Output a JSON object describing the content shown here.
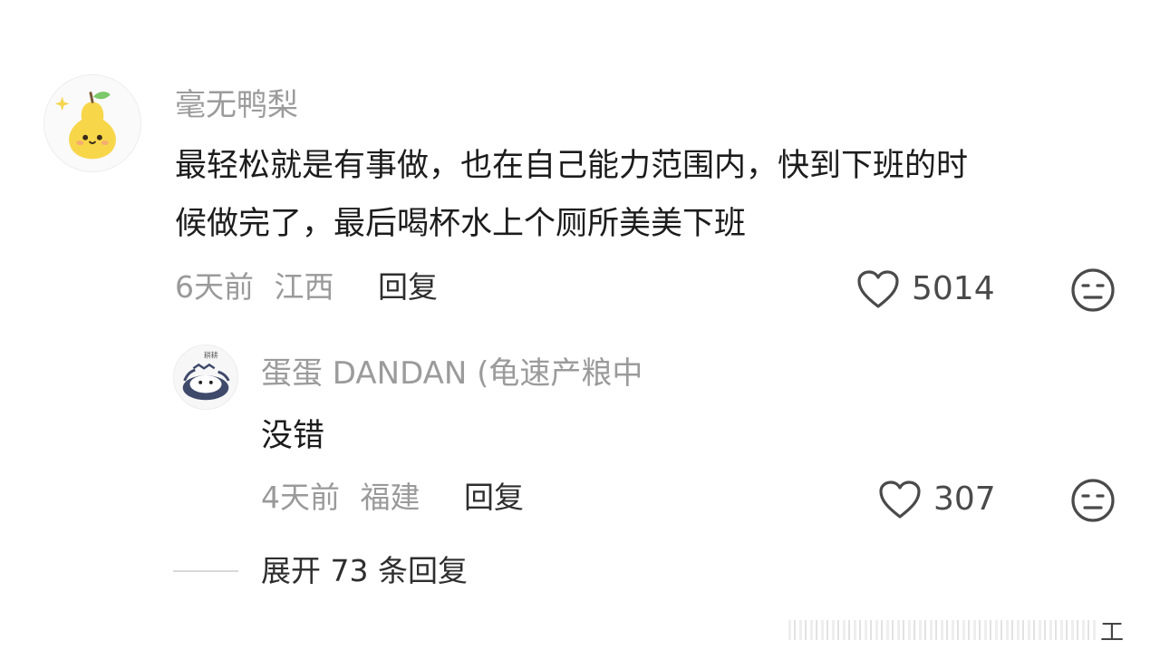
{
  "comment": {
    "username": "毫无鸭梨",
    "text_line1": "最轻松就是有事做，也在自己能力范围内，快到下班的时",
    "text_line2": "候做完了，最后喝杯水上个厕所美美下班",
    "time": "6天前",
    "location": "江西",
    "reply_label": "回复",
    "like_count": "5014",
    "avatar_icon": "pear-avatar-icon",
    "like_icon": "heart-outline-icon",
    "emoji_icon": "neutral-face-icon"
  },
  "reply": {
    "username": "蛋蛋 DANDAN (龟速产粮中",
    "text": "没错",
    "time": "4天前",
    "location": "福建",
    "reply_label": "回复",
    "like_count": "307",
    "avatar_icon": "cat-avatar-icon",
    "like_icon": "heart-outline-icon",
    "emoji_icon": "neutral-face-icon"
  },
  "expand": {
    "label": "展开 73 条回复"
  },
  "watermark": {
    "char": "工"
  },
  "colors": {
    "username": "#9b9b9b",
    "text": "#1c1c1c",
    "meta": "#9a9a9a",
    "action": "#2e2e2e",
    "pear": "#f7d64a"
  }
}
